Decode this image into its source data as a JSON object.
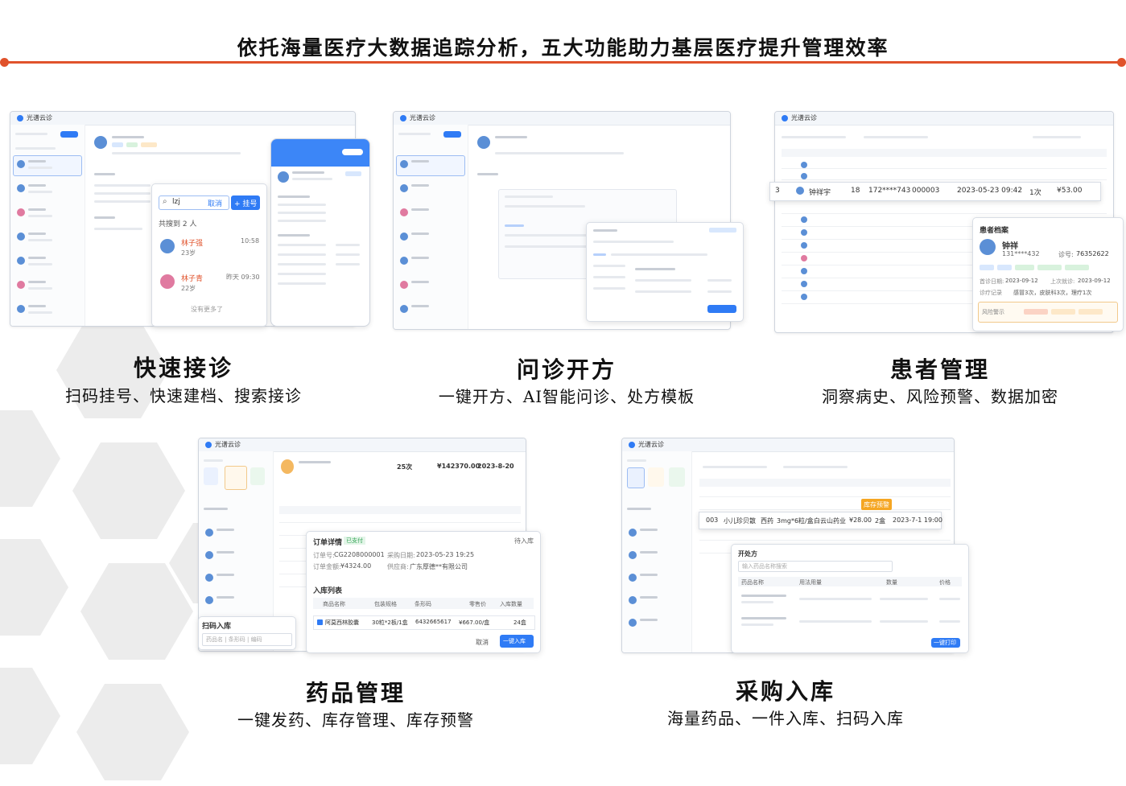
{
  "header": {
    "title": "依托海量医疗大数据追踪分析，五大功能助力基层医疗提升管理效率"
  },
  "colors": {
    "accent": "#e0522b",
    "brand_blue": "#2f7bf5",
    "hex_gray": "#ececec"
  },
  "features": [
    {
      "title": "快速接诊",
      "subtitle": "扫码挂号、快速建档、搜索接诊",
      "screenshot": {
        "search_query": "lzj",
        "cancel_label": "取消",
        "register_label": "+ 挂号",
        "result_count": "共搜到 2 人",
        "results": [
          {
            "name": "林子强",
            "age": "23岁",
            "time": "10:58"
          },
          {
            "name": "林子青",
            "age": "22岁",
            "time": "昨天 09:30"
          }
        ],
        "no_more": "没有更多了"
      }
    },
    {
      "title": "问诊开方",
      "subtitle": "一键开方、AI智能问诊、处方模板"
    },
    {
      "title": "患者管理",
      "subtitle": "洞察病史、风险预警、数据加密",
      "screenshot": {
        "highlight_row": {
          "index": "3",
          "name": "钟祥宇",
          "age": "18",
          "phone": "172****743",
          "card": "000003",
          "date": "2023-05-23 09:42",
          "visits": "1次",
          "amount": "¥53.00"
        },
        "archive_title": "患者档案",
        "archive_name": "钟祥",
        "archive_phone": "131****432",
        "archive_no_label": "诊号:",
        "archive_no": "76352622",
        "first_visit_label": "首诊日期:",
        "first_visit": "2023-09-12",
        "last_visit_label": "上次就诊:",
        "last_visit": "2023-09-12",
        "record_label": "诊疗记录",
        "record_text": "感冒3次，皮肤科3次，理疗1次",
        "risk_label": "风险警示"
      }
    },
    {
      "title": "药品管理",
      "subtitle": "一键发药、库存管理、库存预警",
      "screenshot": {
        "order_title": "订单详情",
        "order_status": "已支付",
        "pending_label": "待入库",
        "order_no_label": "订单号:",
        "order_no": "CG2208000001",
        "purchase_date_label": "采购日期:",
        "purchase_date": "2023-05-23 19:25",
        "amount_label": "订单金额:",
        "amount": "¥4324.00",
        "supplier_label": "供应商:",
        "supplier": "广东厚德**有限公司",
        "list_title": "入库列表",
        "columns": [
          "商品名称",
          "包装规格",
          "条形码",
          "零售价",
          "入库数量"
        ],
        "item": {
          "name": "阿莫西林胶囊",
          "spec": "30粒*2板/1盒",
          "barcode": "6432665617",
          "price": "¥667.00/盒",
          "qty": "24盒"
        },
        "cancel_label": "取消",
        "confirm_label": "一键入库",
        "scan_title": "扫码入库",
        "scan_placeholder": "药品名 | 条形码 | 编码",
        "stat_count": "25次",
        "stat_amount": "¥142370.00",
        "stat_date": "2023-8-20"
      }
    },
    {
      "title": "采购入库",
      "subtitle": "海量药品、一件入库、扫码入库",
      "screenshot": {
        "highlight_row": {
          "index": "003",
          "name": "小儿珍贝散",
          "type": "西药",
          "spec": "3mg*6粒/盒",
          "maker": "白云山药业",
          "price": "¥28.00",
          "stock": "2盒",
          "expire": "2023-7-1 19:00"
        },
        "stock_warning": "库存预警",
        "rx_title": "开处方",
        "rx_search": "输入药品名称搜索",
        "rx_cols": [
          "药品名称",
          "用法用量",
          "数量",
          "价格"
        ],
        "print_label": "一键打印"
      }
    }
  ]
}
